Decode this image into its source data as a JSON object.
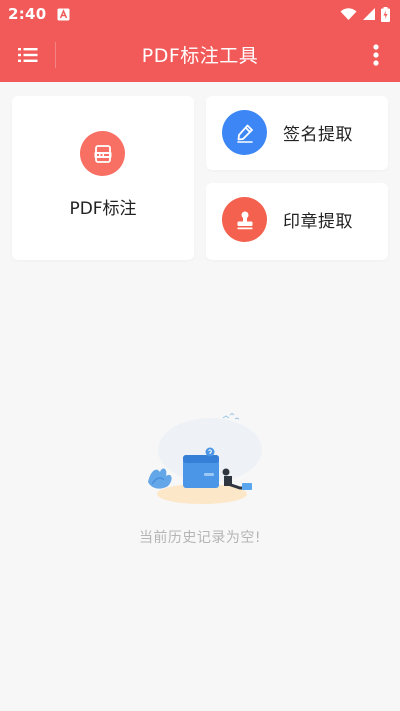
{
  "status_bar": {
    "time": "2:40",
    "icons": [
      "notification-a-icon",
      "wifi-icon",
      "signal-icon",
      "battery-charging-icon"
    ]
  },
  "app_bar": {
    "title": "PDF标注工具",
    "menu_icon": "list-menu-icon",
    "more_icon": "more-vertical-icon"
  },
  "features": {
    "annotate": {
      "label": "PDF标注",
      "icon": "pdf-annotate-icon",
      "color": "#f87064"
    },
    "signature": {
      "label": "签名提取",
      "icon": "pen-icon",
      "color": "#3d86f5"
    },
    "stamp": {
      "label": "印章提取",
      "icon": "stamp-icon",
      "color": "#f4614e"
    }
  },
  "history": {
    "empty_message": "当前历史记录为空!"
  },
  "colors": {
    "primary": "#f25a5a",
    "background": "#f7f7f7"
  }
}
